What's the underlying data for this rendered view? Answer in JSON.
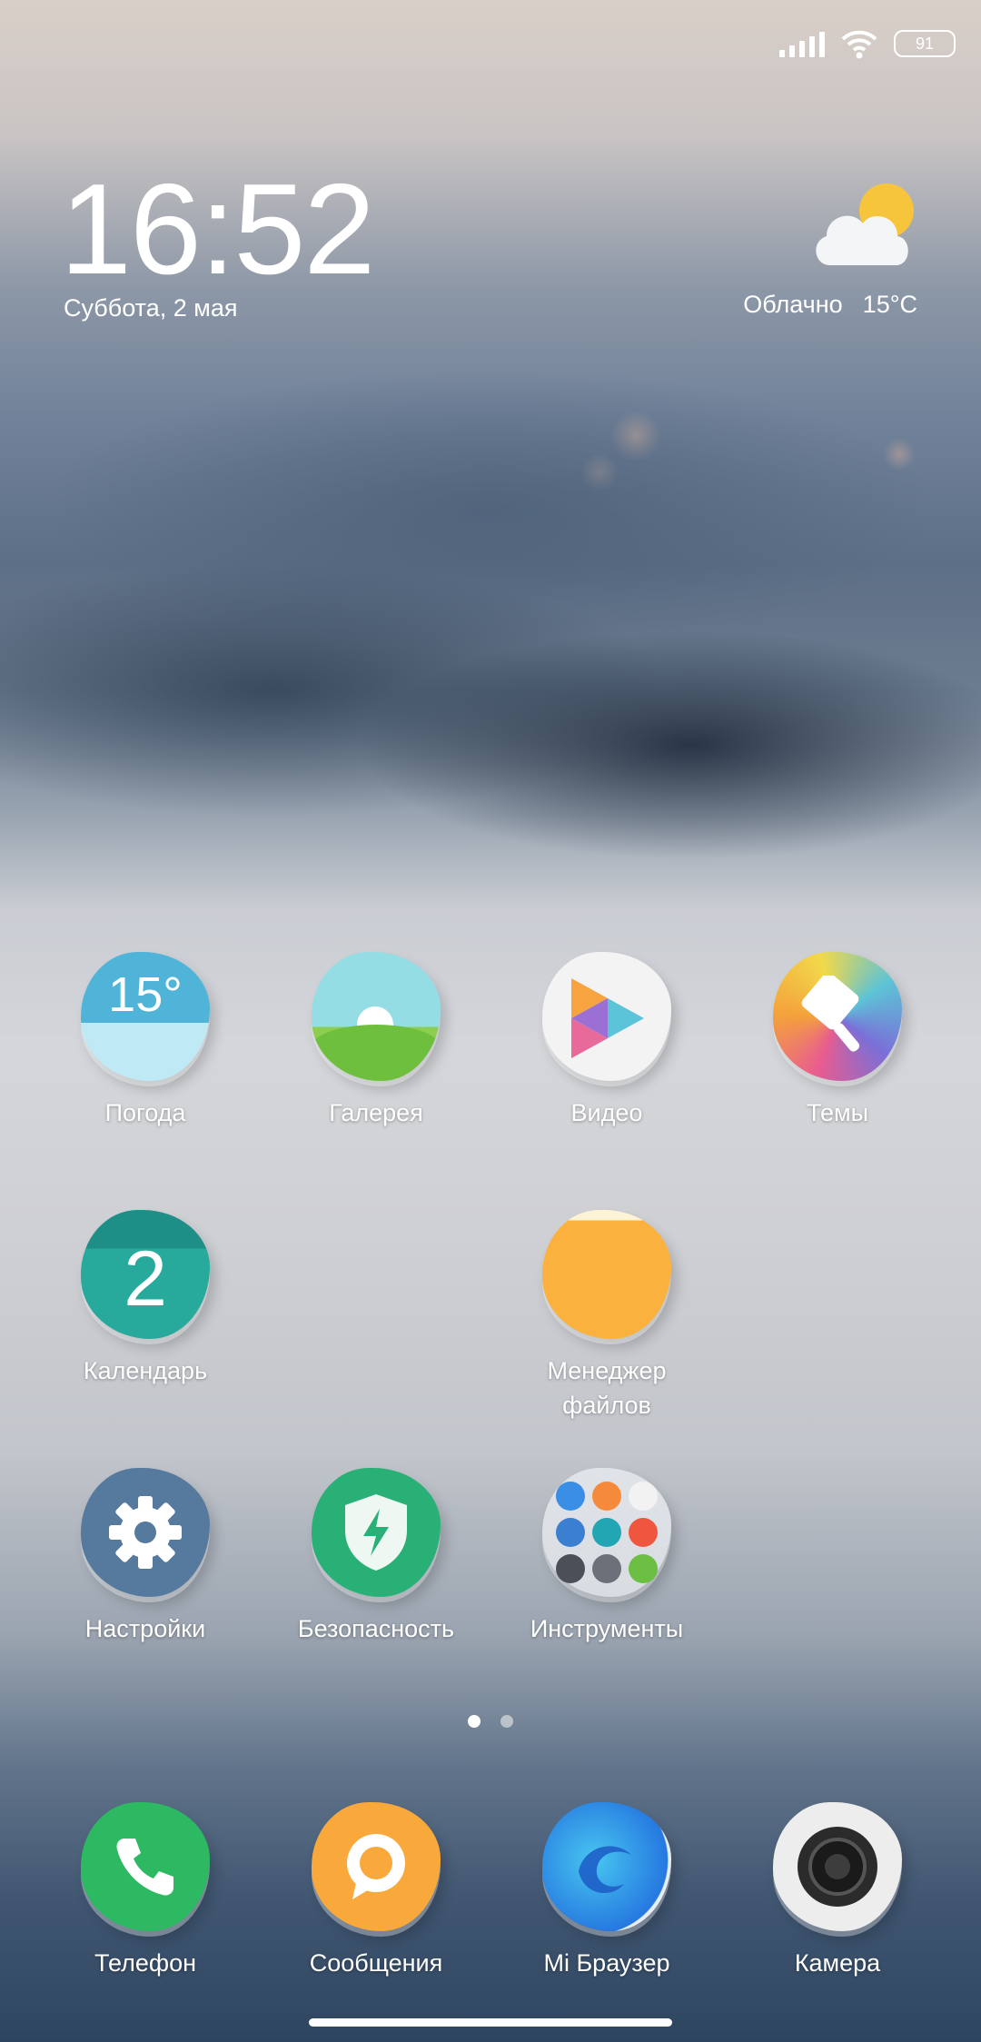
{
  "status_bar": {
    "battery_level": "91",
    "signal_icon": "signal-icon",
    "wifi_icon": "wifi-icon"
  },
  "clock_widget": {
    "time": "16:52",
    "date": "Суббота, 2 мая"
  },
  "weather_widget": {
    "condition": "Облачно",
    "temperature": "15°C",
    "icon": "cloud-sun-icon"
  },
  "apps": {
    "weather": {
      "label": "Погода",
      "icon_text": "15°",
      "color": "#5bb8d6"
    },
    "gallery": {
      "label": "Галерея",
      "color": "#8fd7df"
    },
    "video": {
      "label": "Видео",
      "color": "#f2f2f2"
    },
    "themes": {
      "label": "Темы",
      "color": "#e06a9a"
    },
    "calendar": {
      "label": "Календарь",
      "icon_text": "2",
      "color": "#26a69a"
    },
    "file_manager": {
      "label": "Менеджер\nфайлов",
      "label_line1": "Менеджер",
      "label_line2": "файлов",
      "color": "#fbb040"
    },
    "settings": {
      "label": "Настройки",
      "color": "#5b7fa3"
    },
    "security": {
      "label": "Безопасность",
      "color": "#2bb37a"
    },
    "tools": {
      "label": "Инструменты",
      "color": "#d9dde2"
    }
  },
  "dock": {
    "phone": {
      "label": "Телефон",
      "color": "#2db862"
    },
    "messages": {
      "label": "Сообщения",
      "color": "#f9a93b"
    },
    "browser": {
      "label": "Mi Браузер",
      "color": "#2f8fe6"
    },
    "camera": {
      "label": "Камера",
      "color": "#eeeeee"
    }
  },
  "pages": {
    "count": 2,
    "active": 1
  }
}
